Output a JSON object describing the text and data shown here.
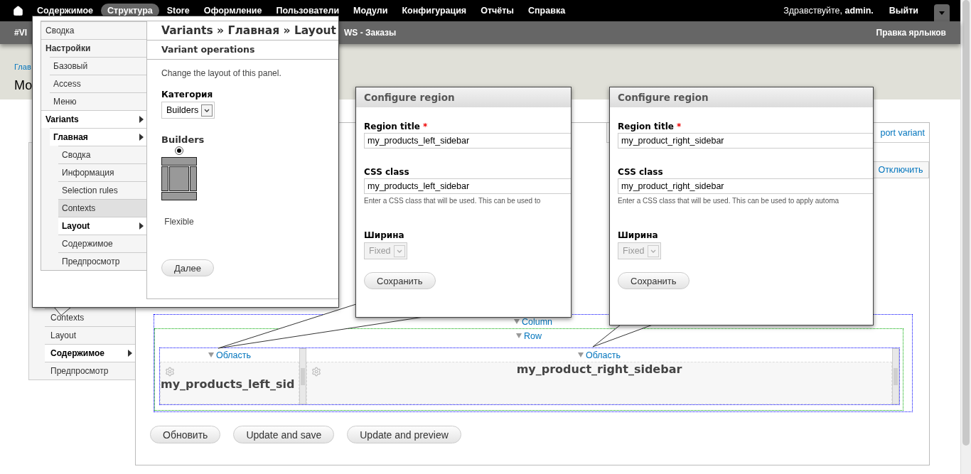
{
  "toolbar": {
    "items": [
      {
        "label": "Содержимое",
        "selected": false
      },
      {
        "label": "Структура",
        "selected": true
      },
      {
        "label": "Store",
        "selected": false
      },
      {
        "label": "Оформление",
        "selected": false
      },
      {
        "label": "Пользователи",
        "selected": false
      },
      {
        "label": "Модули",
        "selected": false
      },
      {
        "label": "Конфигурация",
        "selected": false
      },
      {
        "label": "Отчёты",
        "selected": false
      },
      {
        "label": "Справка",
        "selected": false
      }
    ],
    "greeting": "Здравствуйте, **admin.**",
    "logout": "Выйти"
  },
  "shortcuts": {
    "items": [
      "#VI",
      "WS - Заказы"
    ],
    "edit": "Правка ярлыков"
  },
  "header": {
    "breadcrumb": "Глав",
    "title": "Мо"
  },
  "vertical_tabs": [
    {
      "label": "Contexts",
      "selected": false
    },
    {
      "label": "Layout",
      "selected": false
    },
    {
      "label": "Содержимое",
      "selected": true
    },
    {
      "label": "Предпросмотр",
      "selected": false
    }
  ],
  "panel": {
    "tab": "port variant",
    "disable": "Отключить",
    "layout": {
      "column": "Column",
      "row": "Row",
      "regions": [
        {
          "toggle": "Область",
          "title": "my_products_left_sid"
        },
        {
          "toggle": "Область",
          "title": "my_product_right_sidebar"
        }
      ]
    },
    "buttons": [
      "Обновить",
      "Update and save",
      "Update and preview"
    ]
  },
  "wizard": {
    "nav": [
      {
        "label": "Сводка",
        "active": false
      },
      {
        "label": "Настройки",
        "active": false,
        "children": [
          {
            "label": "Базовый",
            "active": false
          },
          {
            "label": "Access",
            "active": false
          },
          {
            "label": "Меню",
            "active": false
          }
        ]
      },
      {
        "label": "Variants",
        "active": true,
        "children": [
          {
            "label": "Главная",
            "active": true,
            "children": [
              {
                "label": "Сводка",
                "active": false
              },
              {
                "label": "Информация",
                "active": false
              },
              {
                "label": "Selection rules",
                "active": false
              },
              {
                "label": "Contexts",
                "active": false,
                "hovered": true
              },
              {
                "label": "Layout",
                "active": true
              },
              {
                "label": "Содержимое",
                "active": false
              },
              {
                "label": "Предпросмотр",
                "active": false
              }
            ]
          }
        ]
      }
    ],
    "breadcrumb": "Variants » Главная » Layout",
    "subtitle": "Variant operations",
    "description": "Change the layout of this panel.",
    "category_label": "Категория",
    "category": "Builders",
    "group": "Builders",
    "layouts": [
      {
        "label": "Flexible",
        "selected": true
      }
    ],
    "next": "Далее"
  },
  "region_dialogs": [
    {
      "title": "Configure region",
      "fields": [
        {
          "kind": "text",
          "label": "Region title",
          "mark": "*",
          "value": "my_products_left_sidebar"
        },
        {
          "kind": "text",
          "label": "CSS class",
          "value": "my_products_left_sidebar",
          "help": "Enter a CSS class that will be used. This can be used to"
        },
        {
          "kind": "select",
          "label": "Ширина",
          "value": "Fixed",
          "disabled": true
        }
      ],
      "button": "Сохранить"
    },
    {
      "title": "Configure region",
      "fields": [
        {
          "kind": "text",
          "label": "Region title",
          "mark": "*",
          "value": "my_product_right_sidebar"
        },
        {
          "kind": "text",
          "label": "CSS class",
          "value": "my_product_right_sidebar",
          "help": "Enter a CSS class that will be used. This can be used to apply automa"
        },
        {
          "kind": "select",
          "label": "Ширина",
          "value": "Fixed",
          "disabled": true
        }
      ],
      "button": "Сохранить"
    }
  ]
}
